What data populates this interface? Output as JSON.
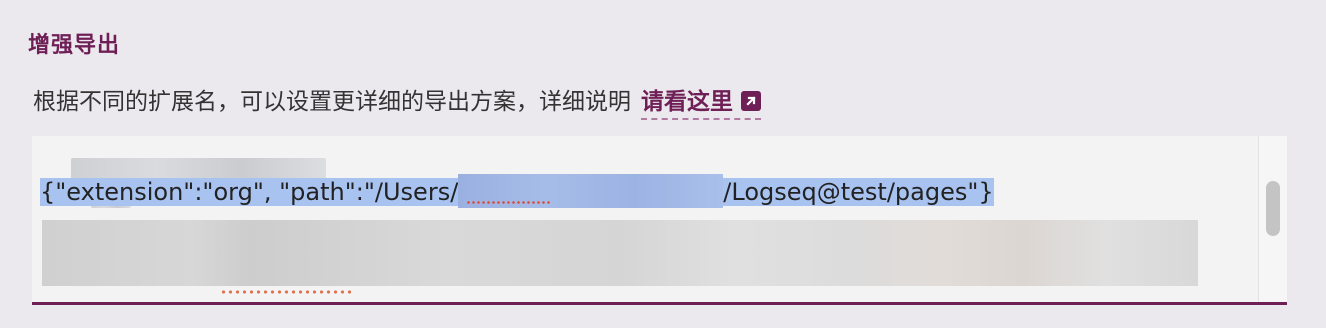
{
  "section": {
    "title": "增强导出"
  },
  "description": {
    "text": "根据不同的扩展名，可以设置更详细的导出方案，详细说明",
    "link_label": "请看这里"
  },
  "editor": {
    "line_2": {
      "prefix": "{\"extension\":\"org\", \"path\":\"/Users/",
      "suffix": "/Logseq@test/pages\"}"
    }
  },
  "colors": {
    "accent": "#6e1f55",
    "selection": "#a9c3f1",
    "background": "#ece9ee"
  }
}
